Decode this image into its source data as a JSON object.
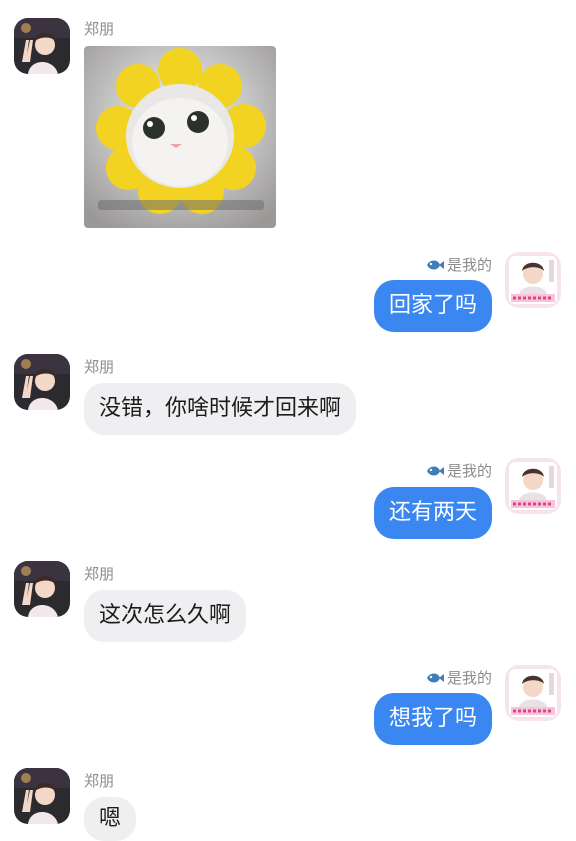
{
  "contacts": {
    "other_name": "郑朋",
    "me_name": "是我的"
  },
  "messages": [
    {
      "sender": "other",
      "type": "image",
      "image": "flower-hat-cat-sticker"
    },
    {
      "sender": "me",
      "type": "text",
      "text": "回家了吗"
    },
    {
      "sender": "other",
      "type": "text",
      "text": "没错，你啥时候才回来啊"
    },
    {
      "sender": "me",
      "type": "text",
      "text": "还有两天"
    },
    {
      "sender": "other",
      "type": "text",
      "text": "这次怎么久啊"
    },
    {
      "sender": "me",
      "type": "text",
      "text": "想我了吗"
    },
    {
      "sender": "other",
      "type": "text",
      "text": "嗯"
    }
  ],
  "colors": {
    "outgoing_bubble": "#3a87f1",
    "incoming_bubble": "#efeff1",
    "name_text": "#8d8d8d"
  },
  "icons": {
    "me_name_badge": "fish-icon"
  }
}
